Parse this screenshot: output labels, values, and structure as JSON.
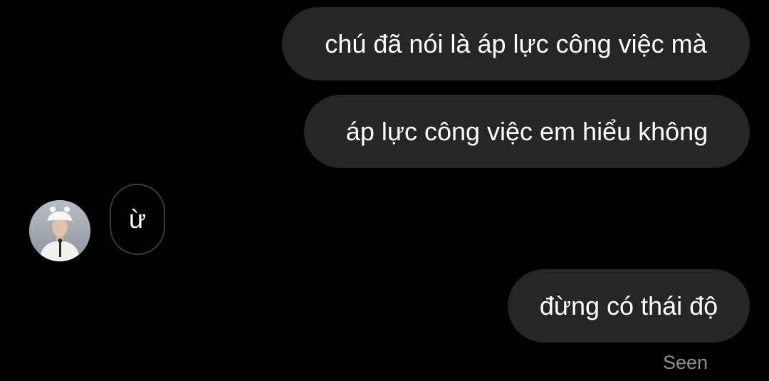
{
  "messages": [
    {
      "from": "me",
      "text": "chú đã nói là áp lực công việc mà"
    },
    {
      "from": "me",
      "text": "áp lực công việc em hiểu không"
    },
    {
      "from": "them",
      "text": "ừ"
    },
    {
      "from": "me",
      "text": "đừng có thái độ"
    }
  ],
  "status": {
    "seen": "Seen"
  },
  "icons": {
    "contact": "avatar-photo"
  },
  "colors": {
    "background": "#000000",
    "outgoing_bubble": "#262626",
    "incoming_border": "#3a3a3a",
    "text": "#ffffff",
    "status_text": "#8e8e8e"
  }
}
